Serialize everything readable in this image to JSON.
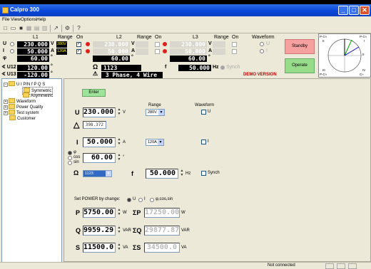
{
  "app": {
    "title": "Calpro 300"
  },
  "menu": [
    "File",
    "View",
    "Options",
    "Help"
  ],
  "meter": {
    "col_headers": {
      "l1": "L1",
      "l2": "L2",
      "l3": "L3",
      "range": "Range",
      "on": "On",
      "waveform": "Waveform"
    },
    "row_labels": {
      "u": "U",
      "i": "I",
      "phi": "φ",
      "u12": "∢ U12",
      "u13": "∢ U13"
    },
    "l1": {
      "u": "230.000",
      "u_range": "280V",
      "i": "50.000",
      "i_range": "120A",
      "phi": "60.00",
      "u12": "120.00",
      "u13": "-120.00"
    },
    "l2": {
      "u": "230.000",
      "i": "50.000",
      "phi": "60.00"
    },
    "l3": {
      "u": "230.000",
      "i": "50.000",
      "phi": "60.00"
    },
    "units": {
      "v": "V",
      "a": "A",
      "deg": "°",
      "hz": "Hz"
    },
    "waveform_options": [
      "U",
      "I"
    ],
    "ohm_value": "1123",
    "connection": "3 Phase, 4 Wire",
    "f_label": "f",
    "f_value": "50.000",
    "synch": "Synch",
    "demo": "DEMO VERSION",
    "standby": "Standby",
    "operate": "Operate"
  },
  "phasor": {
    "labels": [
      "P-C≈",
      "I",
      "C≈",
      "P-C≈",
      "II",
      "III",
      "IV",
      "P-C≈"
    ]
  },
  "tree": {
    "items": [
      "U I P/N f P Q S",
      "Symmetric",
      "Asymmetric",
      "Waveform",
      "Power Quality",
      "Test system",
      "Customer"
    ]
  },
  "form": {
    "enter": "Enter",
    "range": "Range",
    "waveform": "Waveform",
    "u_label": "U",
    "u_value": "230.000",
    "u_unit": "V",
    "u_range": "280V",
    "u_wave": "U",
    "delta_value": "398.372",
    "i_label": "I",
    "i_value": "50.000",
    "i_unit": "A",
    "i_range": "120A",
    "i_wave": "I",
    "phi_opts": [
      "φ",
      "cos",
      "sin"
    ],
    "phi_value": "60.00",
    "phi_unit": "°",
    "ohm_sel": "1123",
    "f_label": "f",
    "f_value": "50.000",
    "f_unit": "Hz",
    "synch": "Synch",
    "set_power": "Set POWER by change:",
    "set_opts": [
      "U",
      "I",
      "φ,cos,sin"
    ],
    "p_label": "P",
    "p_value": "5750.00",
    "p_unit": "W",
    "sp_label": "ΣP",
    "sp_value": "17250.00",
    "sp_unit": "W",
    "q_label": "Q",
    "q_value": "9959.29",
    "q_unit": "VAR",
    "sq_label": "ΣQ",
    "sq_value": "29877.87",
    "sq_unit": "VAR",
    "s_label": "S",
    "s_value": "11500.0",
    "s_unit": "VA",
    "ss_label": "ΣS",
    "ss_value": "34500.0",
    "ss_unit": "VA"
  },
  "status": {
    "text": "Not connected"
  }
}
